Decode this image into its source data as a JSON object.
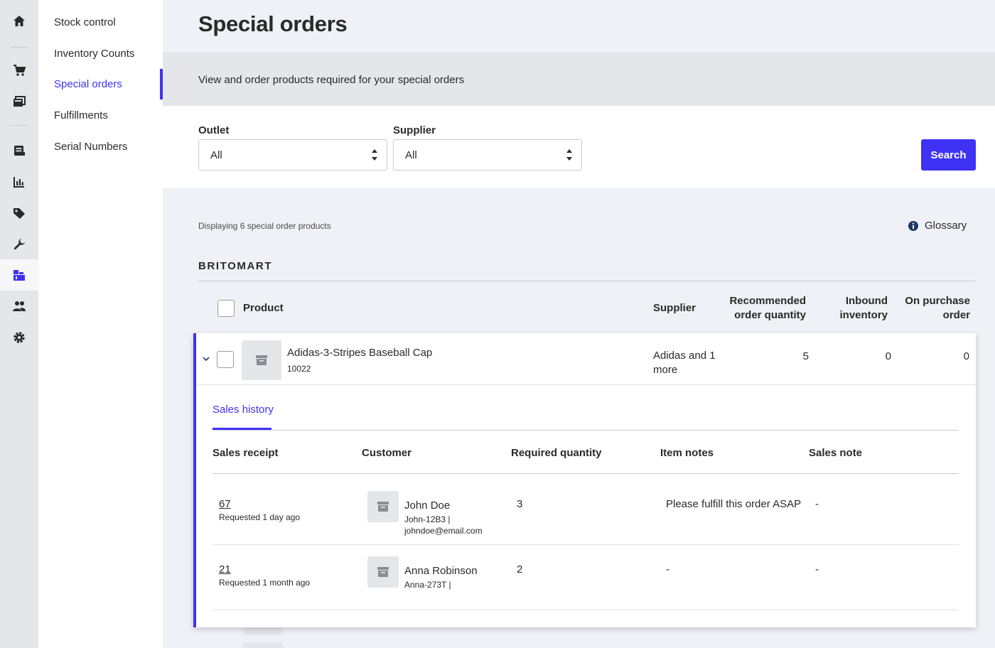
{
  "rail": {
    "icons": [
      "home-icon",
      "cart-icon",
      "catalog-icon",
      "register-icon",
      "reports-icon",
      "tag-icon",
      "wrench-icon",
      "inventory-icon",
      "customers-icon",
      "settings-icon"
    ],
    "active_color": "#3f32f5"
  },
  "subnav": {
    "items": [
      {
        "label": "Stock control"
      },
      {
        "label": "Inventory Counts"
      },
      {
        "label": "Special orders"
      },
      {
        "label": "Fulfillments"
      },
      {
        "label": "Serial Numbers"
      }
    ],
    "active_index": 2
  },
  "page": {
    "title": "Special orders",
    "subtitle": "View and order products required for your special orders"
  },
  "filters": {
    "outlet_label": "Outlet",
    "outlet_value": "All",
    "supplier_label": "Supplier",
    "supplier_value": "All",
    "search_label": "Search"
  },
  "results": {
    "count_text": "Displaying 6 special order products",
    "glossary_label": "Glossary",
    "outlet_name": "BRITOMART"
  },
  "table": {
    "columns": {
      "product": "Product",
      "supplier": "Supplier",
      "recommended_line1": "Recommended",
      "recommended_line2": "order quantity",
      "inbound_line1": "Inbound",
      "inbound_line2": "inventory",
      "purchase_line1": "On purchase",
      "purchase_line2": "order"
    },
    "rows": [
      {
        "name": "Adidas-3-Stripes Baseball Cap",
        "sku": "10022",
        "supplier": "Adidas and 1 more",
        "recommended": "5",
        "inbound": "0",
        "on_purchase": "0"
      }
    ]
  },
  "sales_history": {
    "tab_label": "Sales history",
    "columns": {
      "receipt": "Sales receipt",
      "customer": "Customer",
      "required": "Required quantity",
      "item_notes": "Item notes",
      "sales_note": "Sales note"
    },
    "rows": [
      {
        "receipt": "67",
        "requested": "Requested 1 day ago",
        "customer_name": "John Doe",
        "customer_info": "John-12B3 | johndoe@email.com",
        "required": "3",
        "item_notes": "Please fulfill this order ASAP",
        "sales_note": "-"
      },
      {
        "receipt": "21",
        "requested": "Requested 1 month ago",
        "customer_name": "Anna Robinson",
        "customer_info": "Anna-273T |",
        "required": "2",
        "item_notes": "-",
        "sales_note": "-"
      }
    ]
  }
}
